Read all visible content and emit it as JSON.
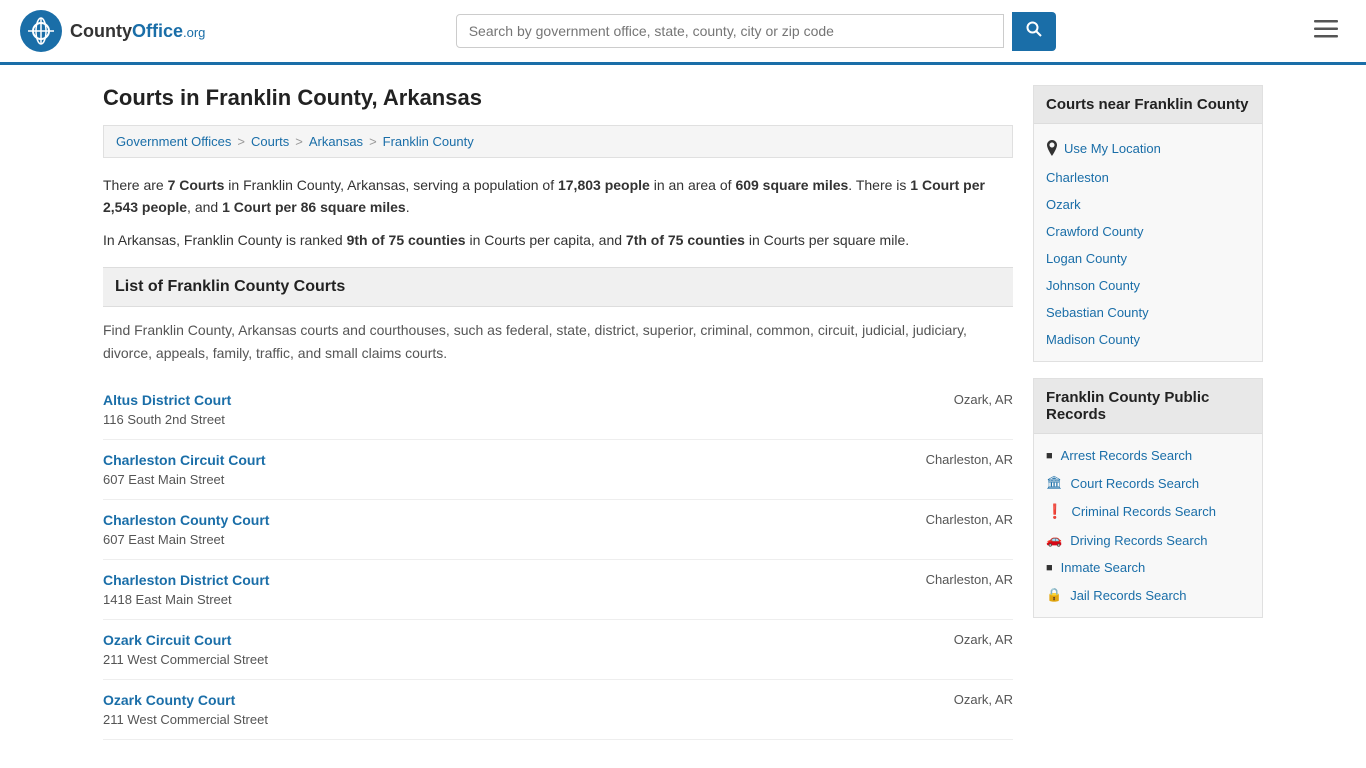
{
  "header": {
    "logo_text": "CountyOffice",
    "logo_org": ".org",
    "search_placeholder": "Search by government office, state, county, city or zip code",
    "search_value": ""
  },
  "page": {
    "title": "Courts in Franklin County, Arkansas",
    "breadcrumbs": [
      {
        "label": "Government Offices",
        "href": "#"
      },
      {
        "label": "Courts",
        "href": "#"
      },
      {
        "label": "Arkansas",
        "href": "#"
      },
      {
        "label": "Franklin County",
        "href": "#"
      }
    ],
    "stats1": "There are ",
    "stats_courts": "7 Courts",
    "stats2": " in Franklin County, Arkansas, serving a population of ",
    "stats_pop": "17,803 people",
    "stats3": " in an area of ",
    "stats_area": "609 square miles",
    "stats4": ". There is ",
    "stats_per_people": "1 Court per 2,543 people",
    "stats5": ", and ",
    "stats_per_sq": "1 Court per 86 square miles",
    "stats6": ".",
    "stats7": "In Arkansas, Franklin County is ranked ",
    "stats_rank1": "9th of 75 counties",
    "stats8": " in Courts per capita, and ",
    "stats_rank2": "7th of 75 counties",
    "stats9": " in Courts per square mile.",
    "list_heading": "List of Franklin County Courts",
    "list_description": "Find Franklin County, Arkansas courts and courthouses, such as federal, state, district, superior, criminal, common, circuit, judicial, judiciary, divorce, appeals, family, traffic, and small claims courts.",
    "courts": [
      {
        "name": "Altus District Court",
        "address": "116 South 2nd Street",
        "location": "Ozark, AR"
      },
      {
        "name": "Charleston Circuit Court",
        "address": "607 East Main Street",
        "location": "Charleston, AR"
      },
      {
        "name": "Charleston County Court",
        "address": "607 East Main Street",
        "location": "Charleston, AR"
      },
      {
        "name": "Charleston District Court",
        "address": "1418 East Main Street",
        "location": "Charleston, AR"
      },
      {
        "name": "Ozark Circuit Court",
        "address": "211 West Commercial Street",
        "location": "Ozark, AR"
      },
      {
        "name": "Ozark County Court",
        "address": "211 West Commercial Street",
        "location": "Ozark, AR"
      }
    ]
  },
  "sidebar": {
    "nearby_title": "Courts near Franklin County",
    "use_location_label": "Use My Location",
    "nearby_links": [
      "Charleston",
      "Ozark",
      "Crawford County",
      "Logan County",
      "Johnson County",
      "Sebastian County",
      "Madison County"
    ],
    "public_records_title": "Franklin County Public Records",
    "public_records_links": [
      {
        "label": "Arrest Records Search",
        "icon": "■"
      },
      {
        "label": "Court Records Search",
        "icon": "🏛"
      },
      {
        "label": "Criminal Records Search",
        "icon": "❗"
      },
      {
        "label": "Driving Records Search",
        "icon": "🚗"
      },
      {
        "label": "Inmate Search",
        "icon": "📋"
      },
      {
        "label": "Jail Records Search",
        "icon": "🔒"
      }
    ]
  }
}
